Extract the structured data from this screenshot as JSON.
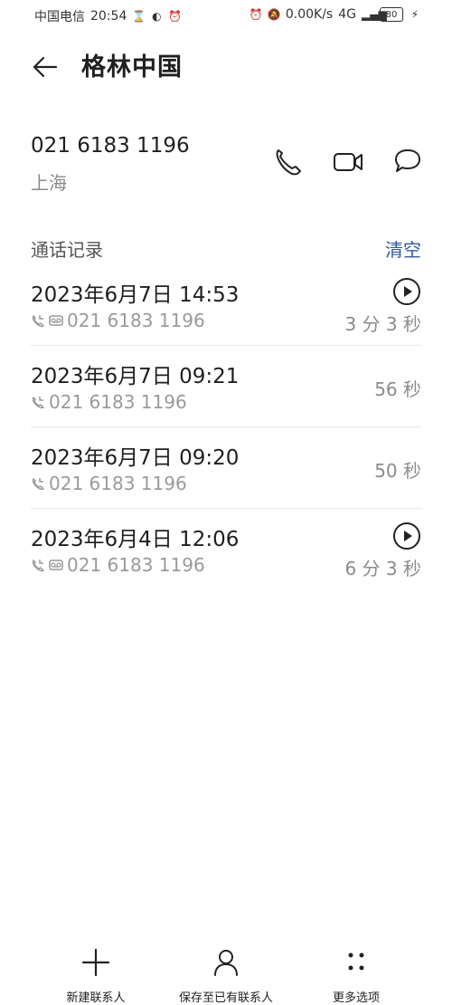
{
  "status_bar": {
    "carrier": "中国电信",
    "time": "20:54",
    "network_speed": "0.00K/s",
    "battery": "80",
    "signal_label": "4G",
    "icons": [
      "hourglass-icon",
      "wechat-icon",
      "alarm-icon",
      "alarm-icon",
      "mute-icon",
      "signal-icon",
      "battery-icon",
      "charging-icon"
    ]
  },
  "header": {
    "back_icon": "arrow-left-icon",
    "title": "格林中国"
  },
  "contact": {
    "number": "021 6183 1196",
    "location": "上海",
    "actions": [
      {
        "name": "call",
        "icon": "phone-icon"
      },
      {
        "name": "video",
        "icon": "video-icon"
      },
      {
        "name": "message",
        "icon": "chat-icon"
      }
    ]
  },
  "call_log": {
    "section_title": "通话记录",
    "clear_label": "清空",
    "items": [
      {
        "date_time": "2023年6月7日 14:53",
        "number": "021 6183 1196",
        "duration": "3 分 3 秒",
        "has_play": true,
        "has_recording_icon": true
      },
      {
        "date_time": "2023年6月7日 09:21",
        "number": "021 6183 1196",
        "duration": "56 秒",
        "has_play": false,
        "has_recording_icon": false
      },
      {
        "date_time": "2023年6月7日 09:20",
        "number": "021 6183 1196",
        "duration": "50 秒",
        "has_play": false,
        "has_recording_icon": false
      },
      {
        "date_time": "2023年6月4日 12:06",
        "number": "021 6183 1196",
        "duration": "6 分 3 秒",
        "has_play": true,
        "has_recording_icon": true
      }
    ]
  },
  "bottom_nav": {
    "items": [
      {
        "label": "新建联系人",
        "icon": "plus-icon"
      },
      {
        "label": "保存至已有联系人",
        "icon": "person-icon"
      },
      {
        "label": "更多选项",
        "icon": "more-icon"
      }
    ]
  },
  "colors": {
    "accent": "#2f5a9a",
    "secondary_text": "#8b8b8b",
    "divider": "#e8e8e8"
  }
}
